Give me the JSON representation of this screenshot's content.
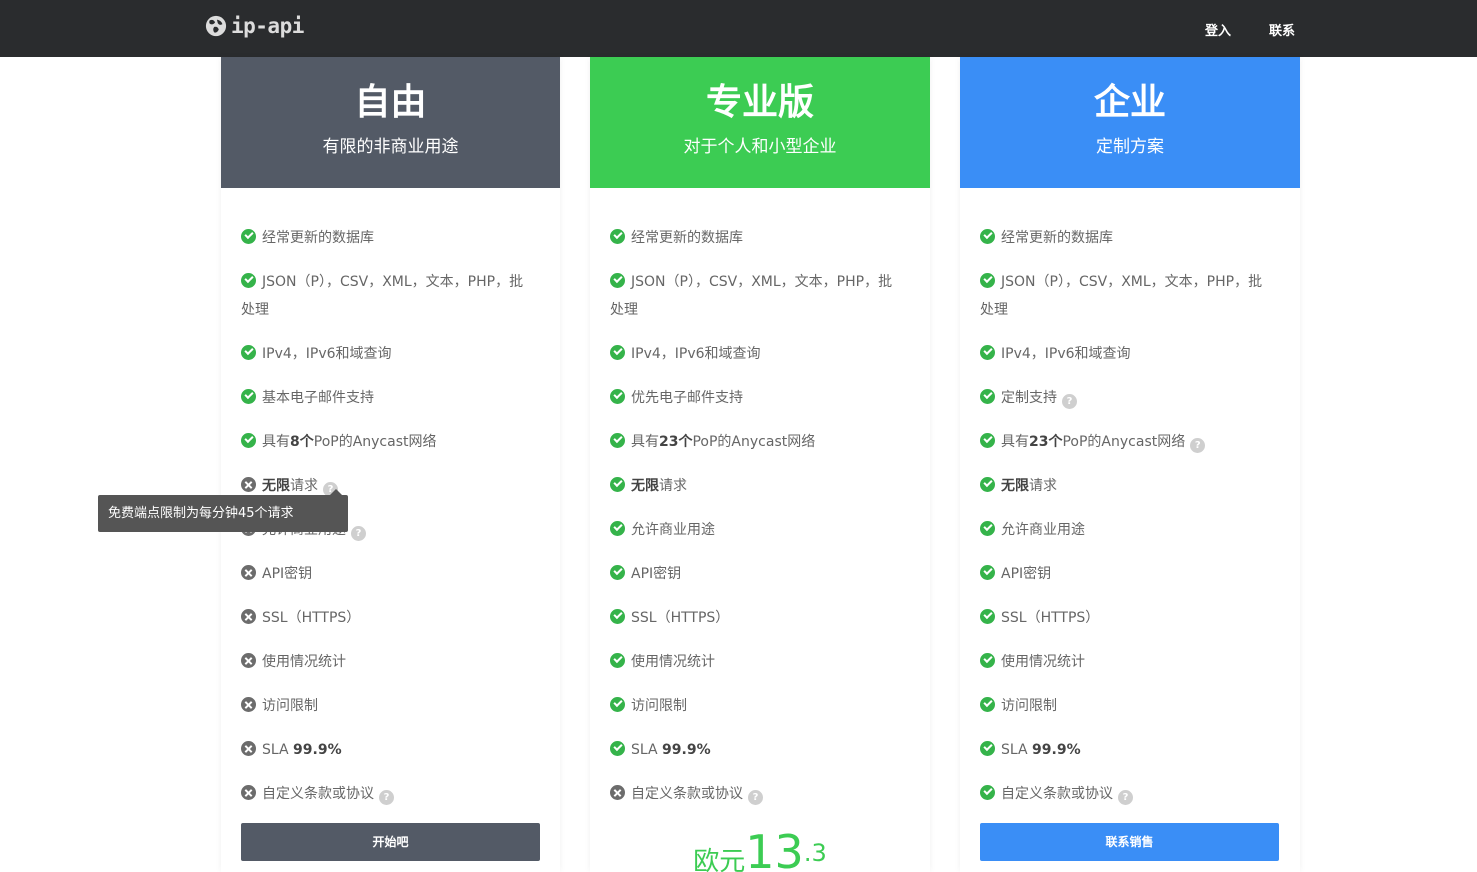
{
  "header": {
    "logo_text": "ip-api",
    "nav": {
      "login": "登入",
      "contact": "联系"
    }
  },
  "plans": [
    {
      "name": "自由",
      "subtitle": "有限的非商业用途",
      "features": [
        {
          "status": "yes",
          "text": "经常更新的数据库"
        },
        {
          "status": "yes",
          "text": "JSON（P），CSV，XML，文本，PHP，批",
          "text2": "处理"
        },
        {
          "status": "yes",
          "text": "IPv4，IPv6和域查询"
        },
        {
          "status": "yes",
          "text": "基本电子邮件支持"
        },
        {
          "status": "yes",
          "pre": "具有",
          "bold": "8个",
          "post": "PoP的Anycast网络"
        },
        {
          "status": "no",
          "bold": "无限",
          "post": "请求",
          "help": true
        },
        {
          "status": "no",
          "text": "允许商业用途",
          "help": true
        },
        {
          "status": "no",
          "text": "API密钥"
        },
        {
          "status": "no",
          "text": "SSL（HTTPS）"
        },
        {
          "status": "no",
          "text": "使用情况统计"
        },
        {
          "status": "no",
          "text": "访问限制"
        },
        {
          "status": "no",
          "pre": "SLA ",
          "bold": "99.9%"
        },
        {
          "status": "no",
          "text": "自定义条款或协议",
          "help": true
        }
      ],
      "button": "开始吧"
    },
    {
      "name": "专业版",
      "subtitle": "对于个人和小型企业",
      "features": [
        {
          "status": "yes",
          "text": "经常更新的数据库"
        },
        {
          "status": "yes",
          "text": "JSON（P），CSV，XML，文本，PHP，批",
          "text2": "处理"
        },
        {
          "status": "yes",
          "text": "IPv4，IPv6和域查询"
        },
        {
          "status": "yes",
          "text": "优先电子邮件支持"
        },
        {
          "status": "yes",
          "pre": "具有",
          "bold": "23个",
          "post": "PoP的Anycast网络"
        },
        {
          "status": "yes",
          "bold": "无限",
          "post": "请求"
        },
        {
          "status": "yes",
          "text": "允许商业用途"
        },
        {
          "status": "yes",
          "text": "API密钥"
        },
        {
          "status": "yes",
          "text": "SSL（HTTPS）"
        },
        {
          "status": "yes",
          "text": "使用情况统计"
        },
        {
          "status": "yes",
          "text": "访问限制"
        },
        {
          "status": "yes",
          "pre": "SLA ",
          "bold": "99.9%"
        },
        {
          "status": "no",
          "text": "自定义条款或协议",
          "help": true
        }
      ],
      "price": {
        "currency": "欧元",
        "amount": "13",
        "decimal": ".3"
      }
    },
    {
      "name": "企业",
      "subtitle": "定制方案",
      "features": [
        {
          "status": "yes",
          "text": "经常更新的数据库"
        },
        {
          "status": "yes",
          "text": "JSON（P），CSV，XML，文本，PHP，批",
          "text2": "处理"
        },
        {
          "status": "yes",
          "text": "IPv4，IPv6和域查询"
        },
        {
          "status": "yes",
          "text": "定制支持",
          "help": true
        },
        {
          "status": "yes",
          "pre": "具有",
          "bold": "23个",
          "post": "PoP的Anycast网络",
          "help": true
        },
        {
          "status": "yes",
          "bold": "无限",
          "post": "请求"
        },
        {
          "status": "yes",
          "text": "允许商业用途"
        },
        {
          "status": "yes",
          "text": "API密钥"
        },
        {
          "status": "yes",
          "text": "SSL（HTTPS）"
        },
        {
          "status": "yes",
          "text": "使用情况统计"
        },
        {
          "status": "yes",
          "text": "访问限制"
        },
        {
          "status": "yes",
          "pre": "SLA ",
          "bold": "99.9%"
        },
        {
          "status": "yes",
          "text": "自定义条款或协议",
          "help": true
        }
      ],
      "button": "联系销售"
    }
  ],
  "tooltip": "免费端点限制为每分钟45个请求",
  "icons": {
    "yes": "check-circle-icon",
    "no": "x-circle-icon",
    "help": "question-circle-icon"
  },
  "colors": {
    "free": "#535a66",
    "pro": "#3ccc53",
    "enterprise": "#3a8ef6",
    "check": "#35b34a"
  }
}
